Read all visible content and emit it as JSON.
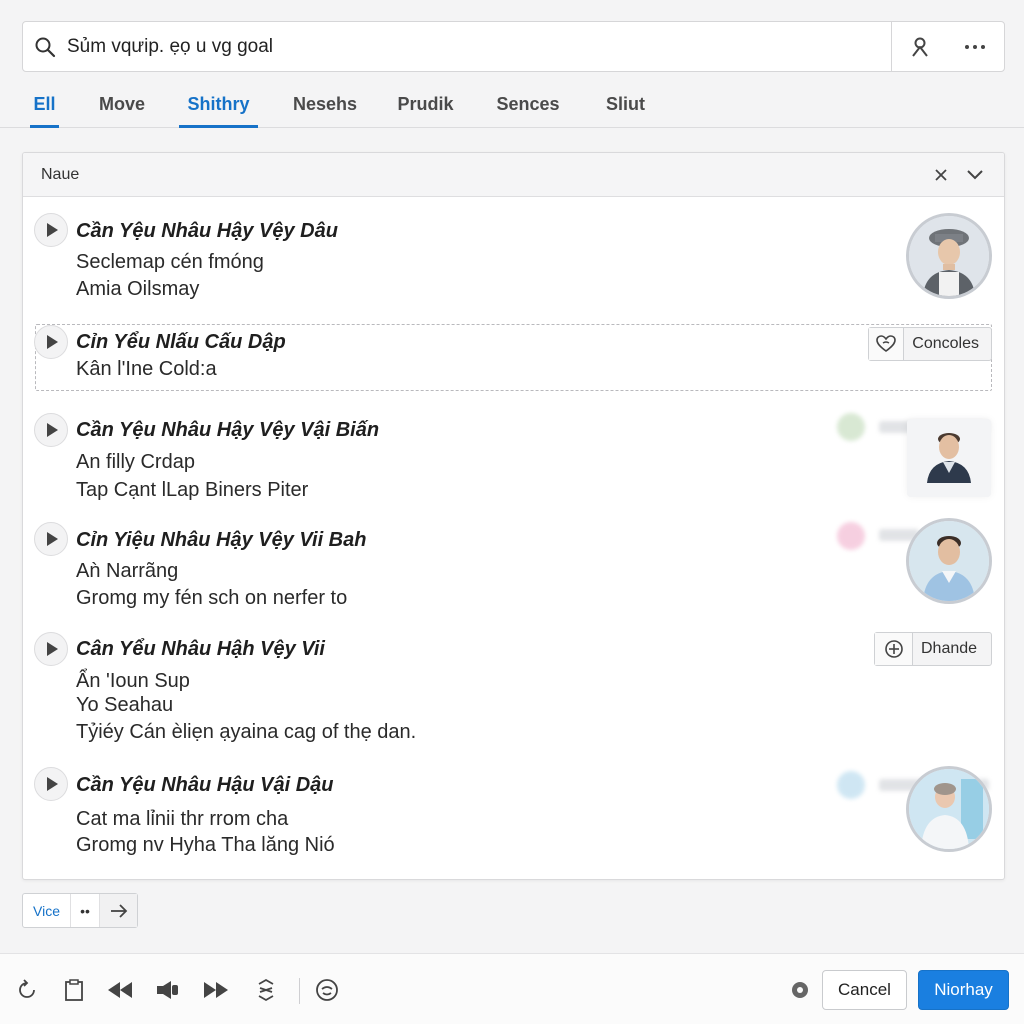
{
  "search": {
    "value": "Sủm vqưip. ẹọ u vg goal",
    "placeholder": ""
  },
  "tabs": [
    {
      "label": "Ell"
    },
    {
      "label": "Move"
    },
    {
      "label": "Shithry",
      "active": true
    },
    {
      "label": "Nesehs"
    },
    {
      "label": "Prudik"
    },
    {
      "label": "Sences"
    },
    {
      "label": "Sliut"
    }
  ],
  "panel": {
    "header_title": "Naue"
  },
  "rows": [
    {
      "title": "Cần Yệu Nhâu Hậy Vệy Dâu",
      "lines": [
        "Seclemap cén fmóng",
        "Amia Oilsmay"
      ]
    },
    {
      "title": "Cỉn Yểu Nlấu Cấu Dập",
      "lines": [
        "Kân l'Ine Cold:a"
      ],
      "action_label": "Concoles"
    },
    {
      "title": "Cần Yệu Nhâu Hậy Vệy Vậi Biấn",
      "lines": [
        "An filly Crdap",
        "Tap Cạnt lLap Biners Piter"
      ]
    },
    {
      "title": "Cỉn Yiệu Nhâu Hậy Vệy Vii Bah",
      "lines": [
        "Aǹ Narrãng",
        "Gromg my fén sch on nerfer to"
      ]
    },
    {
      "title": "Cân Yểu Nhâu Hậh Vệy Vii",
      "lines": [
        "Ẩn 'Ioun Sup",
        "Yo Seahau",
        "Tỷiéy Cán èliẹn ạyaina cag of thẹ dan."
      ],
      "action_label": "Dhande"
    },
    {
      "title": "Cần Yệu Nhâu Hậu Vậi Dậu",
      "lines": [
        "Cat ma lỉnii thr rrom cha",
        "Gromg nv Hyha Tha lăng Nió"
      ]
    }
  ],
  "pager": {
    "label": "Vice",
    "dots": "••"
  },
  "footer": {
    "cancel_label": "Cancel",
    "primary_label": "Niorhay"
  },
  "colors": {
    "accent": "#1672c8",
    "primary_button": "#1a7fe0"
  }
}
